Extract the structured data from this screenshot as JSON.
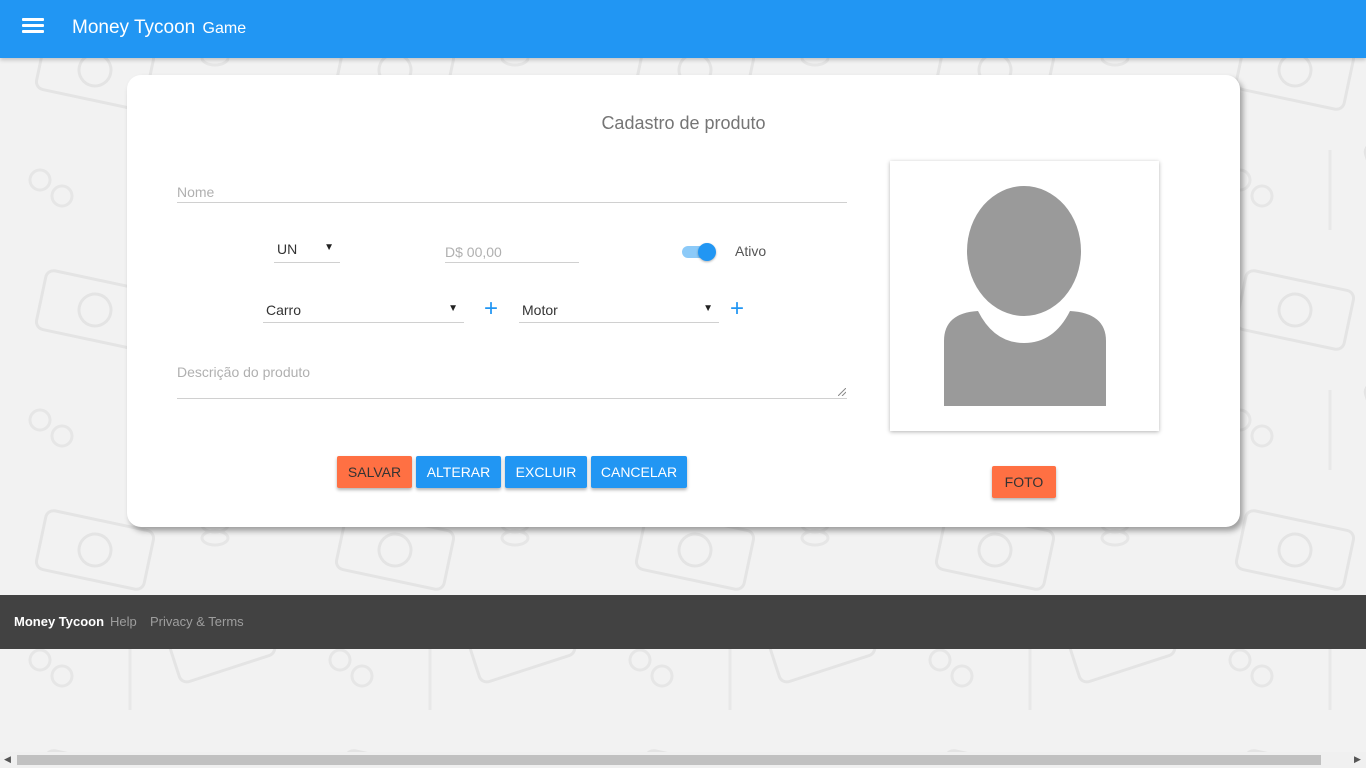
{
  "app": {
    "title": "Money Tycoon",
    "subtitle": "Game"
  },
  "header": {
    "menu_icon": "hamburger-menu-icon"
  },
  "form": {
    "title": "Cadastro de produto",
    "nome_placeholder": "Nome",
    "unit_value": "UN",
    "price_placeholder": "D$ 00,00",
    "active_label": "Ativo",
    "active_on": true,
    "category_value": "Carro",
    "subcategory_value": "Motor",
    "add_symbol": "+",
    "description_placeholder": "Descrição do produto"
  },
  "buttons": {
    "salvar": "SALVAR",
    "alterar": "ALTERAR",
    "excluir": "EXCLUIR",
    "cancelar": "CANCELAR",
    "foto": "FOTO"
  },
  "footer": {
    "brand": "Money Tycoon",
    "help": "Help",
    "privacy": "Privacy & Terms"
  },
  "colors": {
    "primary": "#2196f3",
    "accent": "#ff7043",
    "footer_bg": "#424242"
  }
}
